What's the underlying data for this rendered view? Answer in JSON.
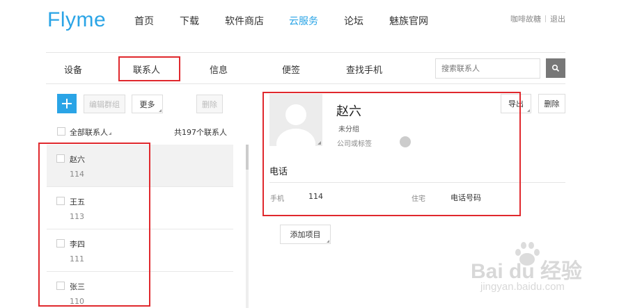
{
  "header": {
    "logo": "Flyme",
    "nav": [
      "首页",
      "下载",
      "软件商店",
      "云服务",
      "论坛",
      "魅族官网"
    ],
    "active_nav": "云服务",
    "user_name": "咖啡故糖",
    "logout": "退出"
  },
  "tabs": [
    "设备",
    "联系人",
    "信息",
    "便签",
    "查找手机"
  ],
  "active_tab": "联系人",
  "search": {
    "placeholder": "搜索联系人"
  },
  "toolbar": {
    "add": "+",
    "edit_group": "编辑群组",
    "more": "更多",
    "delete": "删除"
  },
  "list_header": {
    "all_label": "全部联系人",
    "count_text": "共197个联系人"
  },
  "contacts": [
    {
      "name": "赵六",
      "phone": "114",
      "selected": true
    },
    {
      "name": "王五",
      "phone": "113",
      "selected": false
    },
    {
      "name": "李四",
      "phone": "111",
      "selected": false
    },
    {
      "name": "张三",
      "phone": "110",
      "selected": false
    }
  ],
  "detail": {
    "name": "赵六",
    "group": "未分组",
    "company_placeholder": "公司或标签",
    "export": "导出",
    "delete": "删除",
    "section_phone": "电话",
    "mobile_label": "手机",
    "mobile_value": "114",
    "home_label": "住宅",
    "home_placeholder": "电话号码",
    "add_item": "添加项目"
  },
  "watermark": {
    "brand": "Bai du 经验",
    "url": "jingyan.baidu.com"
  },
  "colors": {
    "accent": "#2aa4e6",
    "highlight": "#e0282d"
  }
}
